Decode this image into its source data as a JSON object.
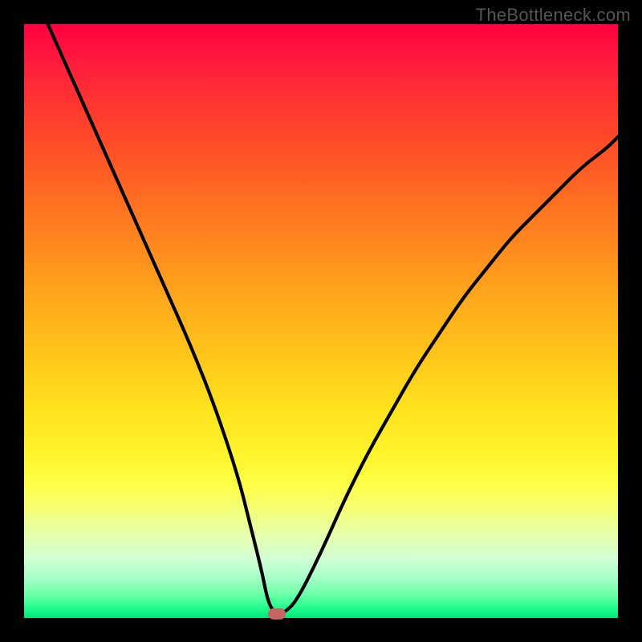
{
  "watermark": "TheBottleneck.com",
  "colors": {
    "frame": "#000000",
    "gradient_top": "#ff0040",
    "gradient_bottom": "#00e67a",
    "curve": "#000000",
    "marker": "#c86464"
  },
  "chart_data": {
    "type": "line",
    "title": "",
    "xlabel": "",
    "ylabel": "",
    "xlim": [
      0,
      100
    ],
    "ylim": [
      0,
      100
    ],
    "x": [
      4,
      8,
      12,
      16,
      20,
      24,
      28,
      32,
      36,
      38,
      40,
      41,
      42,
      43,
      44,
      46,
      50,
      54,
      58,
      62,
      66,
      70,
      74,
      78,
      82,
      86,
      90,
      94,
      98,
      100
    ],
    "y": [
      100,
      91,
      82,
      73,
      64,
      55,
      46,
      36,
      24,
      16,
      8,
      3,
      1,
      1,
      1,
      3,
      11,
      20,
      28,
      35,
      42,
      48,
      54,
      59,
      64,
      68,
      72,
      76,
      79,
      81
    ],
    "marker": {
      "x": 42.5,
      "y": 0.7
    },
    "note": "V-shaped bottleneck curve; minimum (0% mismatch) near x≈42."
  }
}
